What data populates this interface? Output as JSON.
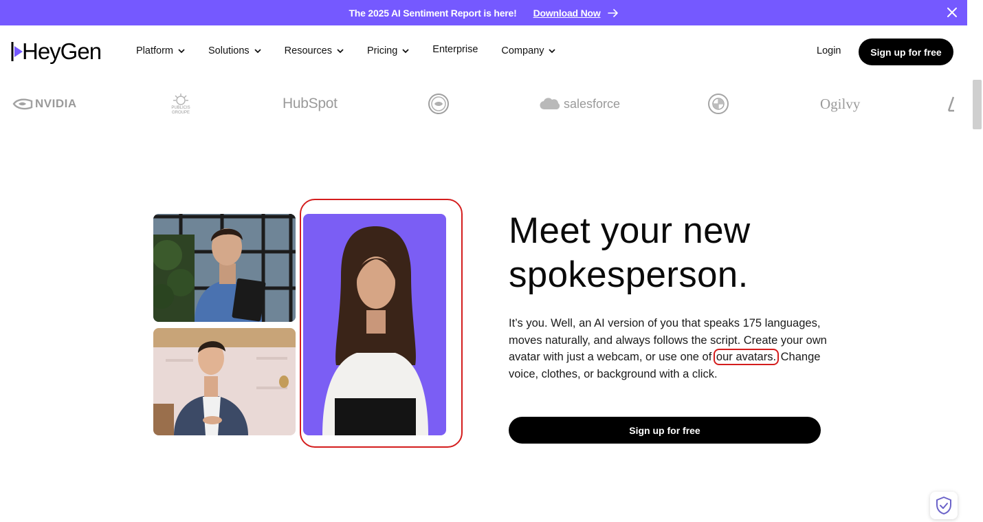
{
  "banner": {
    "text": "The 2025 AI Sentiment Report is here!",
    "link_label": "Download Now",
    "background": "#7559ff"
  },
  "header": {
    "logo_text": "HeyGen",
    "nav": [
      {
        "label": "Platform",
        "has_dropdown": true
      },
      {
        "label": "Solutions",
        "has_dropdown": true
      },
      {
        "label": "Resources",
        "has_dropdown": true
      },
      {
        "label": "Pricing",
        "has_dropdown": true
      },
      {
        "label": "Enterprise",
        "has_dropdown": false
      },
      {
        "label": "Company",
        "has_dropdown": true
      }
    ],
    "login_label": "Login",
    "signup_label": "Sign up for free"
  },
  "logos": {
    "nvidia": "NVIDIA",
    "publicis": "PUBLICIS GROUPE",
    "hubspot": "HubSpot",
    "salesforce": "salesforce",
    "ogilvy": "Ogilvy"
  },
  "hero": {
    "headline_line1": "Meet your new",
    "headline_line2": "spokesperson.",
    "body_part1": "It’s you. Well, an AI version of you that speaks 175 languages, moves naturally, and always follows the script. Create your own avatar with just a webcam, or use one of",
    "body_link": "our avatars.",
    "body_part2": "Change voice, clothes, or background with a click.",
    "cta_label": "Sign up for free"
  },
  "colors": {
    "accent": "#7559ff",
    "button": "#000000",
    "highlight": "#d41d1d"
  }
}
